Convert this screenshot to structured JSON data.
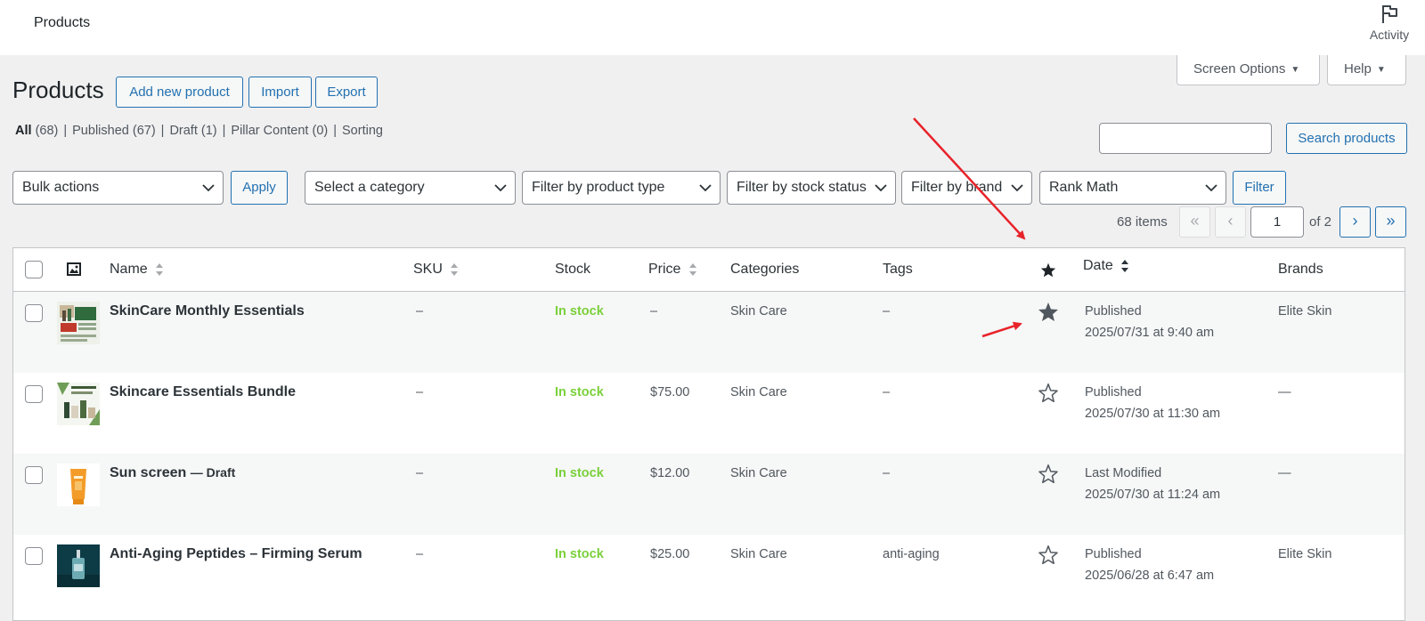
{
  "topbar": {
    "title": "Products",
    "activity_label": "Activity"
  },
  "screen_options_label": "Screen Options",
  "help_label": "Help",
  "page": {
    "title": "Products",
    "add_new_label": "Add new product",
    "import_label": "Import",
    "export_label": "Export"
  },
  "views": [
    {
      "label": "All",
      "count": "(68)"
    },
    {
      "label": "Published",
      "count": "(67)"
    },
    {
      "label": "Draft",
      "count": "(1)"
    },
    {
      "label": "Pillar Content",
      "count": "(0)"
    },
    {
      "label": "Sorting",
      "count": ""
    }
  ],
  "search": {
    "value": "",
    "button_label": "Search products"
  },
  "filters": {
    "bulk_actions": "Bulk actions",
    "apply_label": "Apply",
    "category": "Select a category",
    "product_type": "Filter by product type",
    "stock_status": "Filter by stock status",
    "brand": "Filter by brand",
    "rank_math": "Rank Math",
    "filter_label": "Filter"
  },
  "pagination": {
    "items_label": "68 items",
    "first": "«",
    "prev": "‹",
    "current_page": "1",
    "of_label": "of 2",
    "next": "›",
    "last": "»"
  },
  "columns": {
    "name": "Name",
    "sku": "SKU",
    "stock": "Stock",
    "price": "Price",
    "categories": "Categories",
    "tags": "Tags",
    "date": "Date",
    "brands": "Brands"
  },
  "products": [
    {
      "name": "SkinCare Monthly Essentials",
      "state": "",
      "sku": "–",
      "stock": "In stock",
      "price": "–",
      "categories": "Skin Care",
      "tags": "–",
      "featured": true,
      "date_status": "Published",
      "date": "2025/07/31 at 9:40 am",
      "brand": "Elite Skin",
      "thumb": "skincare-package"
    },
    {
      "name": "Skincare Essentials Bundle",
      "state": "",
      "sku": "–",
      "stock": "In stock",
      "price": "$75.00",
      "categories": "Skin Care",
      "tags": "–",
      "featured": false,
      "date_status": "Published",
      "date": "2025/07/30 at 11:30 am",
      "brand": "—",
      "thumb": "skincare-bundle"
    },
    {
      "name": "Sun screen",
      "state": "— Draft",
      "sku": "–",
      "stock": "In stock",
      "price": "$12.00",
      "categories": "Skin Care",
      "tags": "–",
      "featured": false,
      "date_status": "Last Modified",
      "date": "2025/07/30 at 11:24 am",
      "brand": "—",
      "thumb": "sunscreen-tube"
    },
    {
      "name": "Anti-Aging Peptides – Firming Serum",
      "state": "",
      "sku": "–",
      "stock": "In stock",
      "price": "$25.00",
      "categories": "Skin Care",
      "tags": "anti-aging",
      "featured": false,
      "date_status": "Published",
      "date": "2025/06/28 at 6:47 am",
      "brand": "Elite Skin",
      "thumb": "serum-bottle"
    }
  ],
  "colors": {
    "link": "#2271b1",
    "in_stock": "#7ad03a",
    "annotation_arrow": "#e8232a"
  }
}
